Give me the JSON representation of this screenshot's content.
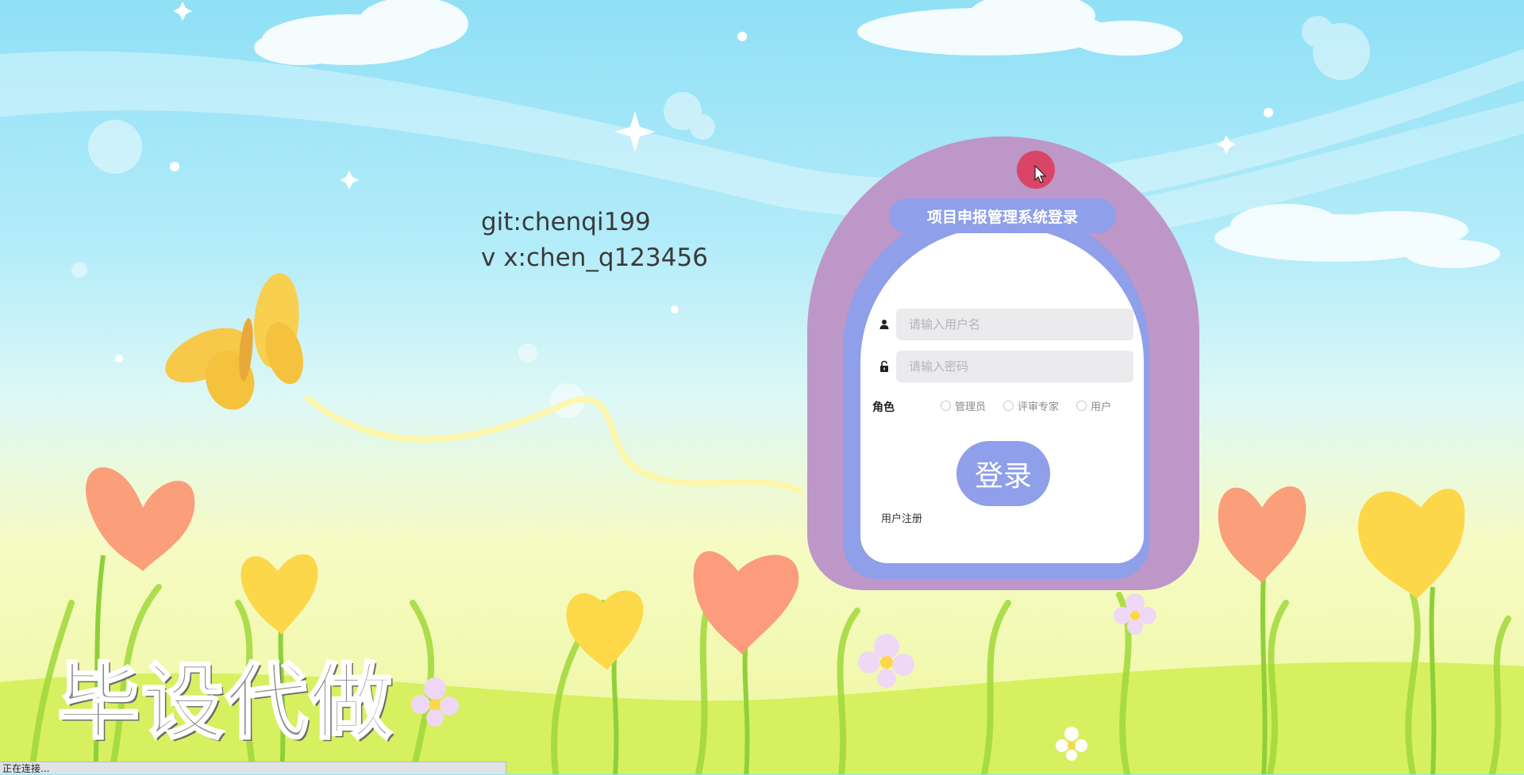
{
  "credits": {
    "git": "git:chenqi199",
    "wechat": "v x:chen_q123456"
  },
  "watermark": "毕设代做",
  "status_bar": {
    "text": "正在连接..."
  },
  "login": {
    "title": "项目申报管理系统登录",
    "username_placeholder": "请输入用户名",
    "password_placeholder": "请输入密码",
    "role_label": "角色",
    "roles": [
      "管理员",
      "评审专家",
      "用户"
    ],
    "login_button": "登录",
    "register_link": "用户注册"
  },
  "icons": {
    "username": "user-icon",
    "password": "lock-icon",
    "cursor": "mouse-pointer-icon"
  },
  "colors": {
    "card_outer": "#bd97c7",
    "accent": "#8f9fe9",
    "cursor_highlight": "#dd3c5c",
    "input_bg": "#ebebee"
  }
}
